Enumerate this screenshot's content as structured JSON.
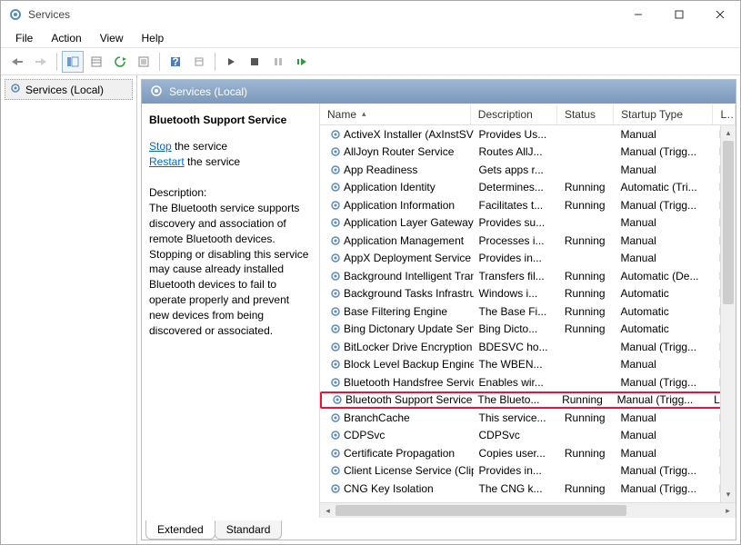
{
  "window": {
    "title": "Services"
  },
  "menubar": [
    "File",
    "Action",
    "View",
    "Help"
  ],
  "tree": {
    "root": "Services (Local)"
  },
  "detail_header": "Services (Local)",
  "leftpane": {
    "title": "Bluetooth Support Service",
    "stop_link": "Stop",
    "stop_suffix": " the service",
    "restart_link": "Restart",
    "restart_suffix": " the service",
    "desc_label": "Description:",
    "desc_text": "The Bluetooth service supports discovery and association of remote Bluetooth devices.  Stopping or disabling this service may cause already installed Bluetooth devices to fail to operate properly and prevent new devices from being discovered or associated."
  },
  "columns": {
    "name": "Name",
    "description": "Description",
    "status": "Status",
    "startup": "Startup Type",
    "logon": "Lo"
  },
  "tabs": {
    "extended": "Extended",
    "standard": "Standard"
  },
  "services": [
    {
      "name": "ActiveX Installer (AxInstSV)",
      "desc": "Provides Us...",
      "status": "",
      "startup": "Manual",
      "log": "Lo"
    },
    {
      "name": "AllJoyn Router Service",
      "desc": "Routes AllJ...",
      "status": "",
      "startup": "Manual (Trigg...",
      "log": "Lo"
    },
    {
      "name": "App Readiness",
      "desc": "Gets apps r...",
      "status": "",
      "startup": "Manual",
      "log": "Lo"
    },
    {
      "name": "Application Identity",
      "desc": "Determines...",
      "status": "Running",
      "startup": "Automatic (Tri...",
      "log": "Lo"
    },
    {
      "name": "Application Information",
      "desc": "Facilitates t...",
      "status": "Running",
      "startup": "Manual (Trigg...",
      "log": "Lo"
    },
    {
      "name": "Application Layer Gateway S...",
      "desc": "Provides su...",
      "status": "",
      "startup": "Manual",
      "log": "Lo"
    },
    {
      "name": "Application Management",
      "desc": "Processes i...",
      "status": "Running",
      "startup": "Manual",
      "log": "Lo"
    },
    {
      "name": "AppX Deployment Service (...",
      "desc": "Provides in...",
      "status": "",
      "startup": "Manual",
      "log": "Lo"
    },
    {
      "name": "Background Intelligent Trans...",
      "desc": "Transfers fil...",
      "status": "Running",
      "startup": "Automatic (De...",
      "log": "Lo"
    },
    {
      "name": "Background Tasks Infrastruc...",
      "desc": "Windows i...",
      "status": "Running",
      "startup": "Automatic",
      "log": "Lo"
    },
    {
      "name": "Base Filtering Engine",
      "desc": "The Base Fi...",
      "status": "Running",
      "startup": "Automatic",
      "log": "Lo"
    },
    {
      "name": "Bing Dictonary Update Service",
      "desc": "Bing Dicto...",
      "status": "Running",
      "startup": "Automatic",
      "log": "Lo"
    },
    {
      "name": "BitLocker Drive Encryption S...",
      "desc": "BDESVC ho...",
      "status": "",
      "startup": "Manual (Trigg...",
      "log": "Lo"
    },
    {
      "name": "Block Level Backup Engine S...",
      "desc": "The WBEN...",
      "status": "",
      "startup": "Manual",
      "log": "Lo"
    },
    {
      "name": "Bluetooth Handsfree Service",
      "desc": "Enables wir...",
      "status": "",
      "startup": "Manual (Trigg...",
      "log": "Lo"
    },
    {
      "name": "Bluetooth Support Service",
      "desc": "The Blueto...",
      "status": "Running",
      "startup": "Manual (Trigg...",
      "log": "Lo",
      "highlight": true
    },
    {
      "name": "BranchCache",
      "desc": "This service...",
      "status": "Running",
      "startup": "Manual",
      "log": "Ne"
    },
    {
      "name": "CDPSvc",
      "desc": "CDPSvc",
      "status": "",
      "startup": "Manual",
      "log": "Lo"
    },
    {
      "name": "Certificate Propagation",
      "desc": "Copies user...",
      "status": "Running",
      "startup": "Manual",
      "log": "Lo"
    },
    {
      "name": "Client License Service (ClipS...",
      "desc": "Provides in...",
      "status": "",
      "startup": "Manual (Trigg...",
      "log": "Lo"
    },
    {
      "name": "CNG Key Isolation",
      "desc": "The CNG k...",
      "status": "Running",
      "startup": "Manual (Trigg...",
      "log": "Lo"
    }
  ]
}
